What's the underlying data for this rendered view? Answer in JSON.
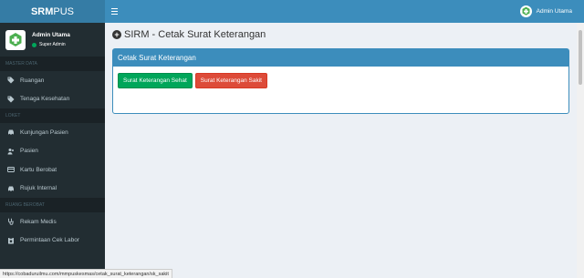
{
  "brand": {
    "bold": "SRM",
    "light": "PUS"
  },
  "user": {
    "name": "Admin Utama",
    "role": "Super Admin"
  },
  "topbar": {
    "username": "Admin Utama"
  },
  "sidebar": {
    "sections": [
      {
        "header": "MASTER DATA",
        "items": [
          {
            "label": "Ruangan",
            "icon": "tag-icon"
          },
          {
            "label": "Tenaga Kesehatan",
            "icon": "tag-icon"
          }
        ]
      },
      {
        "header": "LOKET",
        "items": [
          {
            "label": "Kunjungan Pasien",
            "icon": "car-icon"
          },
          {
            "label": "Pasien",
            "icon": "users-icon"
          },
          {
            "label": "Kartu Berobat",
            "icon": "credit-card-icon"
          },
          {
            "label": "Rujuk Internal",
            "icon": "car-icon"
          }
        ]
      },
      {
        "header": "RUANG BEROBAT",
        "items": [
          {
            "label": "Rekam Medis",
            "icon": "stethoscope-icon"
          },
          {
            "label": "Permintaan Cek Labor",
            "icon": "clipboard-icon"
          }
        ]
      }
    ]
  },
  "page": {
    "title": "SIRM - Cetak Surat Keterangan"
  },
  "box": {
    "title": "Cetak Surat Keterangan",
    "buttons": {
      "sehat": "Surat Keterangan Sehat",
      "sakit": "Surat Keterangan Sakit"
    }
  },
  "statusbar": {
    "url": "https://cobaduruilmu.com/mmpuskesmas/cetak_surat_keterangan/sk_sakit"
  },
  "colors": {
    "primary": "#3c8dbc",
    "logo_bg": "#357ca5",
    "sidebar": "#222d32",
    "green": "#00a65a",
    "red": "#dd4b39"
  }
}
